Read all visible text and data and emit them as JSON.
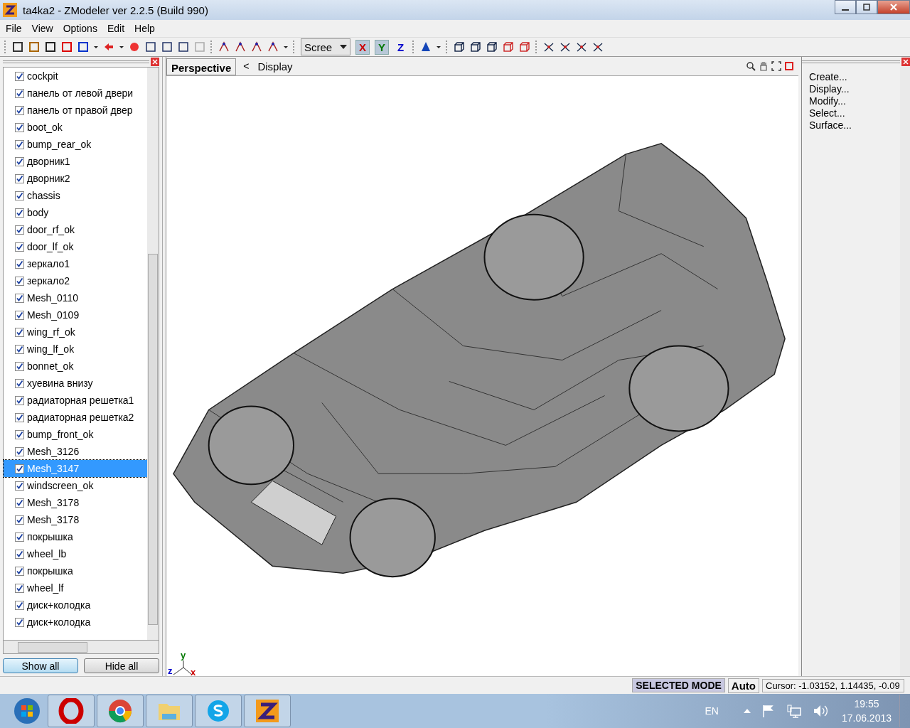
{
  "window": {
    "title": "ta4ka2 - ZModeler ver 2.2.5 (Build 990)"
  },
  "menu": [
    "File",
    "View",
    "Options",
    "Edit",
    "Help"
  ],
  "toolbar": {
    "dropdown": {
      "value": "Scree"
    },
    "axes": [
      {
        "label": "X",
        "selected": true,
        "color": "#cc0000"
      },
      {
        "label": "Y",
        "selected": true,
        "color": "#007700"
      },
      {
        "label": "Z",
        "selected": false,
        "color": "#0000cc"
      }
    ]
  },
  "objects": [
    {
      "name": "cockpit",
      "visible": true,
      "selected": false
    },
    {
      "name": "панель от левой двери",
      "visible": true,
      "selected": false
    },
    {
      "name": "панель от правой двер",
      "visible": true,
      "selected": false
    },
    {
      "name": "boot_ok",
      "visible": true,
      "selected": false
    },
    {
      "name": "bump_rear_ok",
      "visible": true,
      "selected": false
    },
    {
      "name": "дворник1",
      "visible": true,
      "selected": false
    },
    {
      "name": "дворник2",
      "visible": true,
      "selected": false
    },
    {
      "name": "chassis",
      "visible": true,
      "selected": false
    },
    {
      "name": "body",
      "visible": true,
      "selected": false
    },
    {
      "name": "door_rf_ok",
      "visible": true,
      "selected": false
    },
    {
      "name": "door_lf_ok",
      "visible": true,
      "selected": false
    },
    {
      "name": "зеркало1",
      "visible": true,
      "selected": false
    },
    {
      "name": "зеркало2",
      "visible": true,
      "selected": false
    },
    {
      "name": "Mesh_0110",
      "visible": true,
      "selected": false
    },
    {
      "name": "Mesh_0109",
      "visible": true,
      "selected": false
    },
    {
      "name": "wing_rf_ok",
      "visible": true,
      "selected": false
    },
    {
      "name": "wing_lf_ok",
      "visible": true,
      "selected": false
    },
    {
      "name": "bonnet_ok",
      "visible": true,
      "selected": false
    },
    {
      "name": "хуевина внизу",
      "visible": true,
      "selected": false
    },
    {
      "name": "радиаторная решетка1",
      "visible": true,
      "selected": false
    },
    {
      "name": "радиаторная решетка2",
      "visible": true,
      "selected": false
    },
    {
      "name": "bump_front_ok",
      "visible": true,
      "selected": false
    },
    {
      "name": "Mesh_3126",
      "visible": true,
      "selected": false
    },
    {
      "name": "Mesh_3147",
      "visible": true,
      "selected": true
    },
    {
      "name": "windscreen_ok",
      "visible": true,
      "selected": false
    },
    {
      "name": "Mesh_3178",
      "visible": true,
      "selected": false
    },
    {
      "name": "Mesh_3178",
      "visible": true,
      "selected": false
    },
    {
      "name": "покрышка",
      "visible": true,
      "selected": false
    },
    {
      "name": "wheel_lb",
      "visible": true,
      "selected": false
    },
    {
      "name": "покрышка",
      "visible": true,
      "selected": false
    },
    {
      "name": "wheel_lf",
      "visible": true,
      "selected": false
    },
    {
      "name": "диск+колодка",
      "visible": true,
      "selected": false
    },
    {
      "name": "диск+колодка",
      "visible": true,
      "selected": false
    }
  ],
  "object_buttons": [
    {
      "label": "Show all",
      "selected": true
    },
    {
      "label": "Hide all",
      "selected": false
    }
  ],
  "viewport": {
    "tab": "Perspective",
    "panel_toggle": "<",
    "panel_label": "Display",
    "axis_labels": [
      {
        "label": "y",
        "color": "#007700"
      },
      {
        "label": "z",
        "color": "#0000cc"
      },
      {
        "label": "x",
        "color": "#cc0000"
      }
    ]
  },
  "command_panel": {
    "items": [
      "Create...",
      "Display...",
      "Modify...",
      "Select...",
      "Surface..."
    ]
  },
  "status_bar": {
    "mode": "SELECTED MODE",
    "snap": "Auto",
    "cursor": "Cursor: -1.03152, 1.14435, -0.09"
  },
  "taskbar": {
    "language": "EN",
    "time": "19:55",
    "date": "17.06.2013"
  }
}
